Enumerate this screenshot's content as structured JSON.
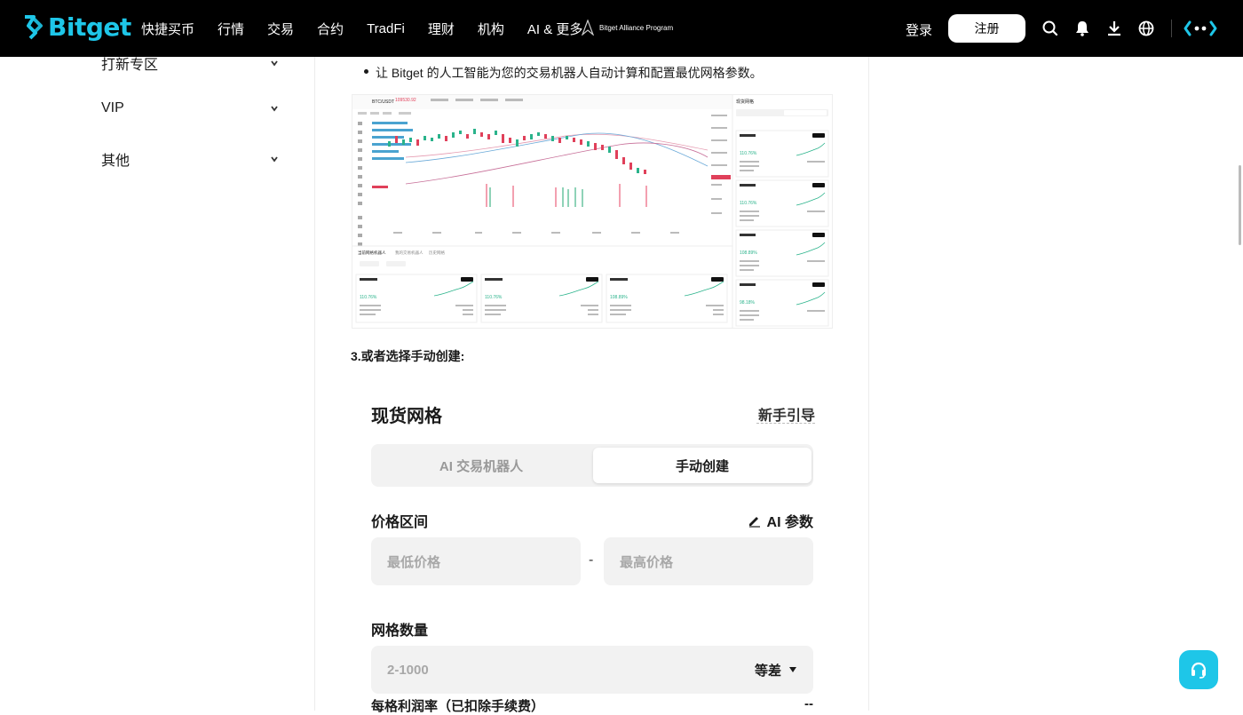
{
  "header": {
    "logo_text": "Bitget",
    "nav": [
      "快捷买币",
      "行情",
      "交易",
      "合约",
      "TradFi",
      "理财",
      "机构",
      "AI & 更多"
    ],
    "alliance_text": "Bitget Alliance Program",
    "login_label": "登录",
    "register_label": "注册",
    "icons": [
      "search-icon",
      "bell-icon",
      "download-icon",
      "globe-icon",
      "settings-icon"
    ]
  },
  "sidebar": {
    "items": [
      {
        "label": "打新专区"
      },
      {
        "label": "VIP"
      },
      {
        "label": "其他"
      }
    ]
  },
  "content": {
    "bullet_text": "让 Bitget 的人工智能为您的交易机器人自动计算和配置最优网格参数。",
    "section_heading": "3.或者选择手动创建:",
    "chart_screenshot": {
      "pair": "BTC/USDT",
      "price": "109530.92",
      "tabs": [
        "当前网格机器人",
        "我的交易机器人",
        "历史网格"
      ],
      "panel_title": "现货网格",
      "cards": [
        {
          "pair": "BTC/USDT",
          "roi": "110.76%"
        },
        {
          "pair": "BTC/USDT",
          "roi": "110.76%"
        },
        {
          "pair": "BTC/USDT",
          "roi": "108.89%"
        },
        {
          "pair": "BTC/USDT",
          "roi": "98.18%"
        }
      ]
    },
    "form": {
      "title": "现货网格",
      "guide_label": "新手引导",
      "tab_ai": "AI 交易机器人",
      "tab_manual": "手动创建",
      "price_range_label": "价格区间",
      "ai_param_label": "AI 参数",
      "min_price_placeholder": "最低价格",
      "dash": "-",
      "max_price_placeholder": "最高价格",
      "grid_count_label": "网格数量",
      "grid_count_placeholder": "2-1000",
      "grid_mode": "等差",
      "profit_label": "每格利润率（已扣除手续费）",
      "profit_value": "--"
    }
  }
}
